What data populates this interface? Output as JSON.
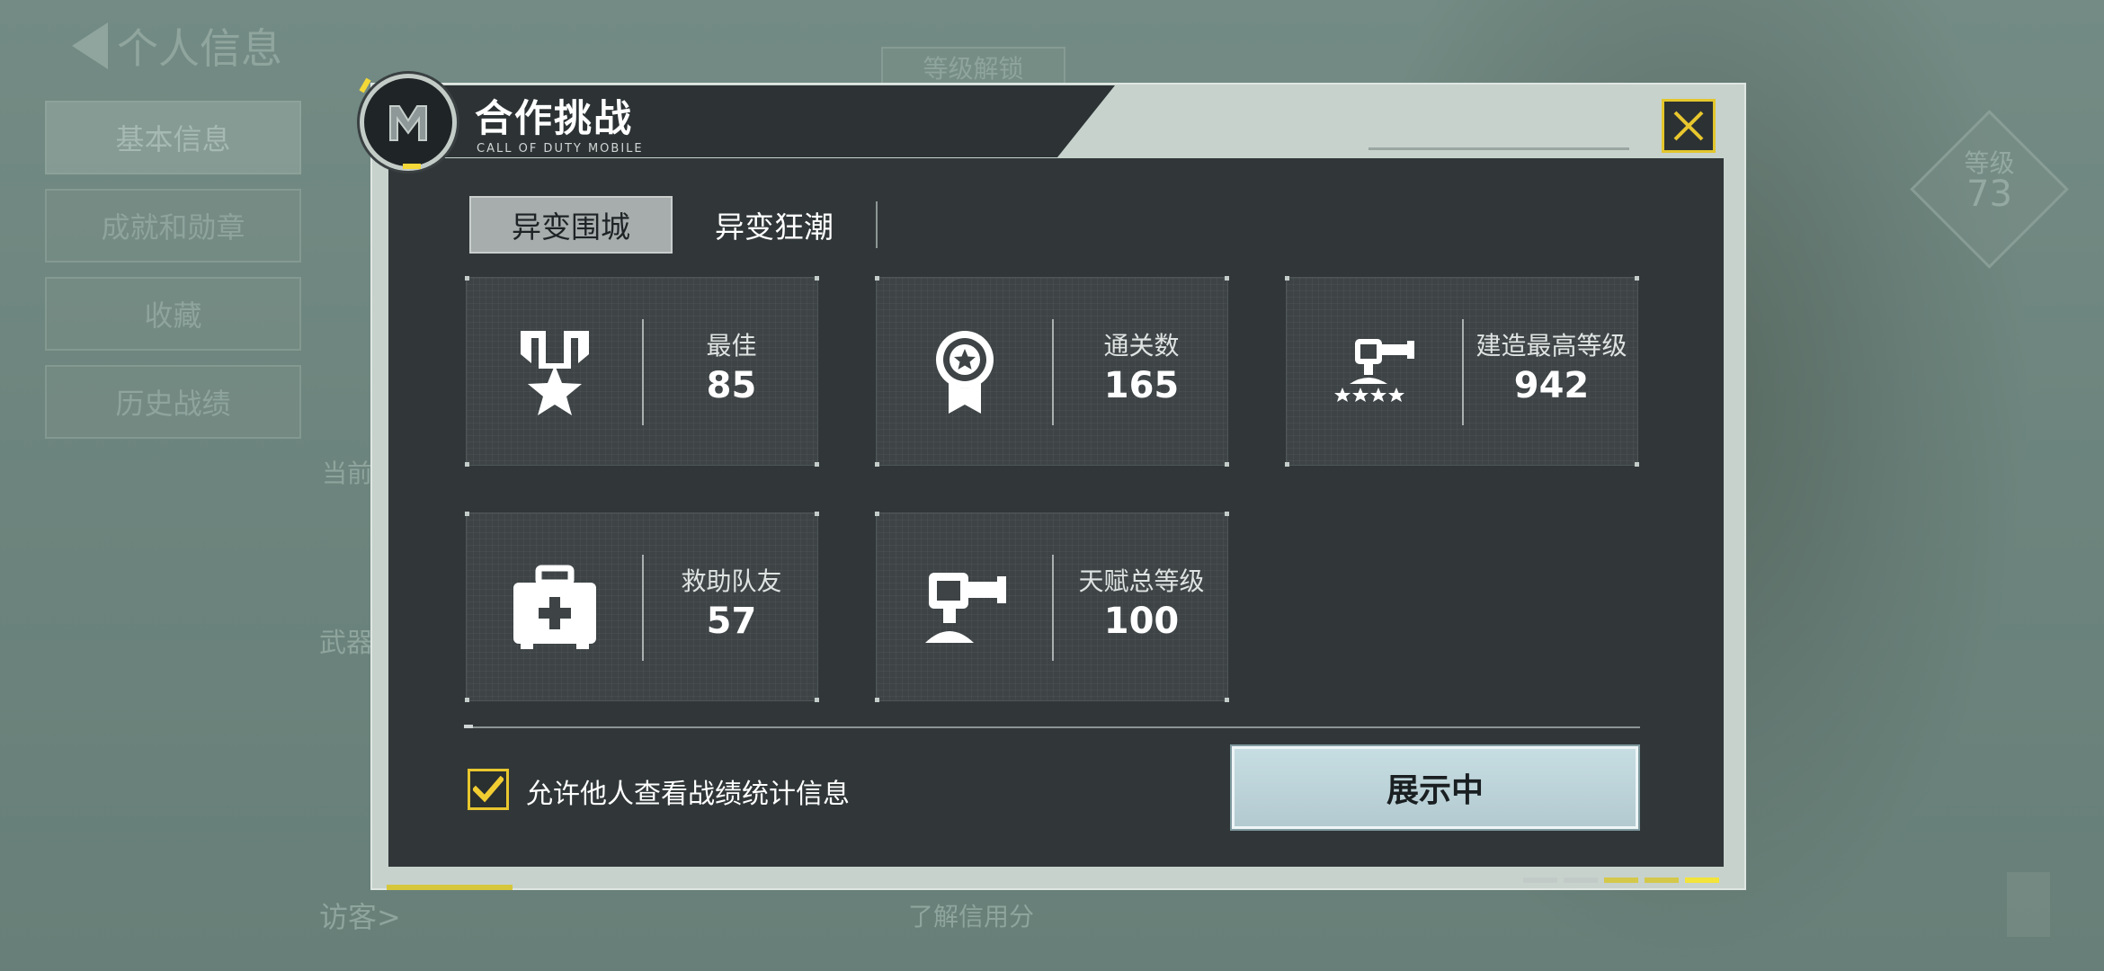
{
  "background": {
    "back_label": "个人信息",
    "menu": [
      "基本信息",
      "成就和勋章",
      "收藏",
      "历史战绩"
    ],
    "level_label": "等级",
    "level_value": "73",
    "unlock_label": "等级解锁",
    "current_label": "当前段",
    "weapon_label": "武器大",
    "visitor_label": "访客>",
    "credit_label": "了解信用分"
  },
  "dialog": {
    "title": "合作挑战",
    "subtitle": "CALL OF DUTY MOBILE",
    "tabs": [
      {
        "label": "异变围城",
        "active": true
      },
      {
        "label": "异变狂潮",
        "active": false
      }
    ],
    "stats": [
      {
        "label": "最佳",
        "value": "85",
        "icon": "medal-star-icon"
      },
      {
        "label": "通关数",
        "value": "165",
        "icon": "ribbon-badge-icon"
      },
      {
        "label": "建造最高等级",
        "value": "942",
        "icon": "turret-stars-icon"
      },
      {
        "label": "救助队友",
        "value": "57",
        "icon": "medkit-icon"
      },
      {
        "label": "天赋总等级",
        "value": "100",
        "icon": "turret-icon"
      }
    ],
    "allow_stats_label": "允许他人查看战绩统计信息",
    "allow_stats_checked": true,
    "show_button_label": "展示中",
    "page_count": 5,
    "current_page_highlight": 5
  },
  "colors": {
    "accent_yellow": "#e8c72e",
    "panel_dark": "#313739",
    "button_blue": "#c6dde2"
  }
}
